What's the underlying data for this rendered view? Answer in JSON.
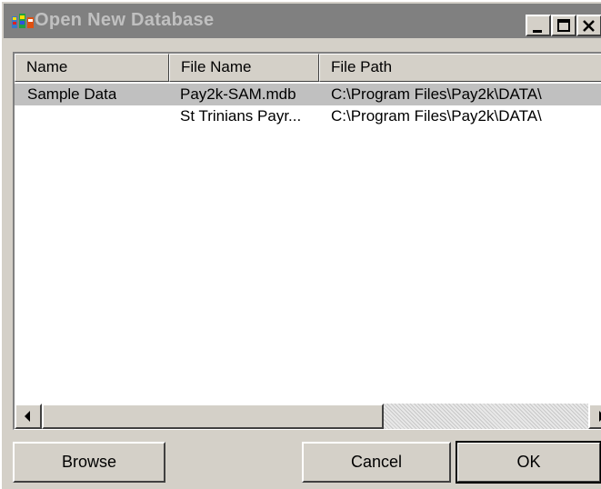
{
  "window": {
    "title": "Open New Database",
    "icon": "app-icon",
    "controls": {
      "minimize": "minimize-icon",
      "maximize": "maximize-icon",
      "close": "close-icon"
    }
  },
  "list": {
    "columns": [
      "Name",
      "File Name",
      "File Path"
    ],
    "rows": [
      {
        "name": "Sample Data",
        "file_name": "Pay2k-SAM.mdb",
        "file_path": "C:\\Program Files\\Pay2k\\DATA\\",
        "selected": true
      },
      {
        "name": "",
        "file_name": "St Trinians Payr...",
        "file_path": "C:\\Program Files\\Pay2k\\DATA\\",
        "selected": false
      }
    ]
  },
  "buttons": {
    "browse": "Browse",
    "cancel": "Cancel",
    "ok": "OK"
  },
  "colors": {
    "face": "#d4d0c8",
    "titlebar_inactive": "#808080",
    "selection": "#c0c0c0"
  }
}
